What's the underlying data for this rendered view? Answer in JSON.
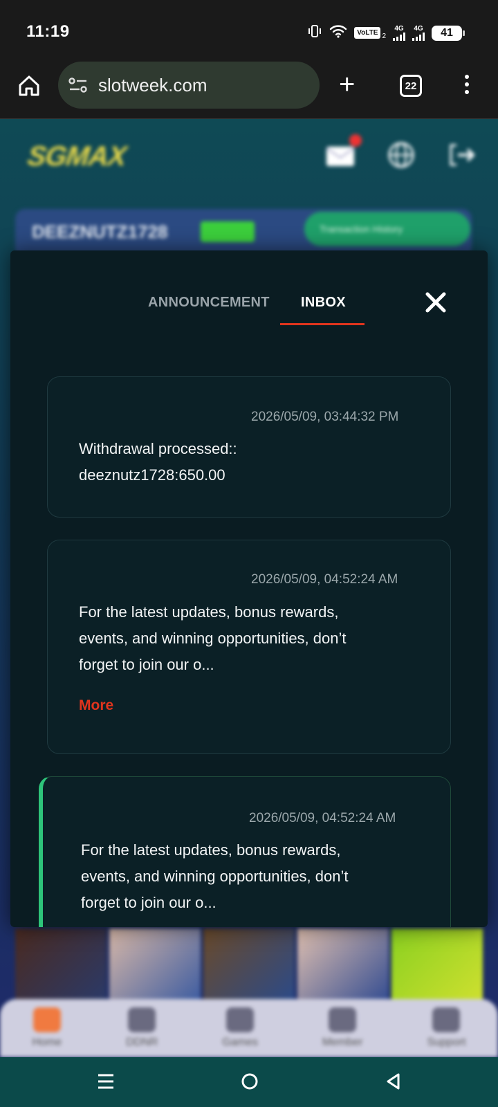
{
  "status_bar": {
    "time": "11:19",
    "volte": "VoLTE",
    "volte_sub": "2",
    "network1": "4G",
    "network2": "4G",
    "battery": "41"
  },
  "browser": {
    "url": "slotweek.com",
    "tab_count": "22"
  },
  "background_page": {
    "logo": "SGMAX",
    "account_name": "DEEZNUTZ1728",
    "transaction_history": "Transaction History",
    "nav": [
      "Home",
      "DDNR",
      "Games",
      "Member",
      "Support"
    ]
  },
  "modal": {
    "tabs": [
      "ANNOUNCEMENT",
      "INBOX"
    ],
    "active_tab": "INBOX",
    "messages": [
      {
        "date": "2026/05/09, 03:44:32 PM",
        "text_line1": "Withdrawal processed::",
        "text_line2": "deeznutz1728:650.00"
      },
      {
        "date": "2026/05/09, 04:52:24 AM",
        "text_line1": "For the latest updates, bonus rewards,",
        "text_line2": "events, and winning opportunities, don’t",
        "text_line3": "forget to join our o...",
        "more": "More"
      },
      {
        "date": "2026/05/09, 04:52:24 AM",
        "text_line1": "For the latest updates, bonus rewards,",
        "text_line2": "events, and winning opportunities, don’t",
        "text_line3": "forget to join our o..."
      }
    ]
  },
  "colors": {
    "accent_red": "#e0341d",
    "unread_green": "#2ec47a",
    "modal_bg": "#0a1c22"
  }
}
